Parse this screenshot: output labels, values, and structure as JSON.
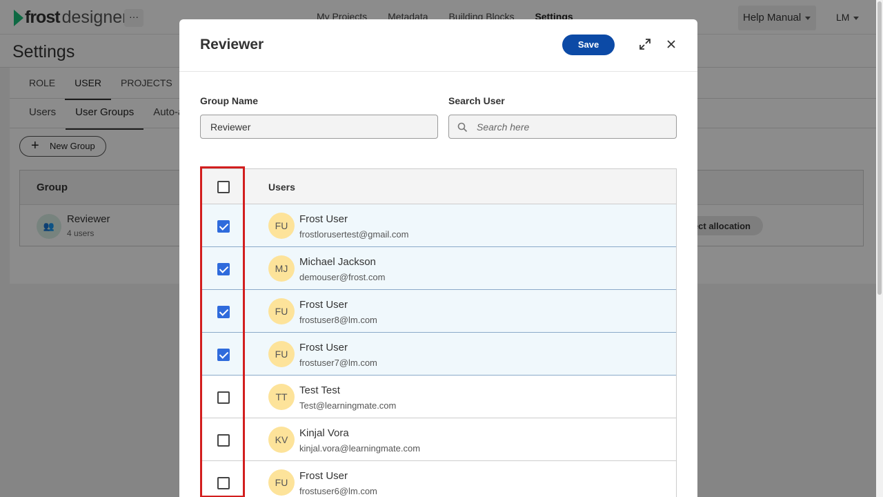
{
  "app": {
    "logo_bold": "frost",
    "logo_light": "designer",
    "more_label": "···",
    "nav": [
      "My Projects",
      "Metadata",
      "Building Blocks",
      "Settings"
    ],
    "help_label": "Help Manual",
    "user_initials": "LM"
  },
  "settings": {
    "title": "Settings",
    "tabs": [
      "ROLE",
      "USER",
      "PROJECTS"
    ],
    "subtabs": [
      "Users",
      "User Groups",
      "Auto-as"
    ],
    "new_group_label": "New Group",
    "group_header": "Group",
    "group_name": "Reviewer",
    "group_count": "4 users",
    "allocation_label": "ect allocation"
  },
  "modal": {
    "title": "Reviewer",
    "save_label": "Save",
    "group_name_label": "Group Name",
    "group_name_value": "Reviewer",
    "search_label": "Search User",
    "search_placeholder": "Search here",
    "users_header": "Users",
    "users": [
      {
        "initials": "FU",
        "name": "Frost User",
        "email": "frostlorusertest@gmail.com",
        "checked": true
      },
      {
        "initials": "MJ",
        "name": "Michael Jackson",
        "email": "demouser@frost.com",
        "checked": true
      },
      {
        "initials": "FU",
        "name": "Frost User",
        "email": "frostuser8@lm.com",
        "checked": true
      },
      {
        "initials": "FU",
        "name": "Frost User",
        "email": "frostuser7@lm.com",
        "checked": true
      },
      {
        "initials": "TT",
        "name": "Test Test",
        "email": "Test@learningmate.com",
        "checked": false
      },
      {
        "initials": "KV",
        "name": "Kinjal Vora",
        "email": "kinjal.vora@learningmate.com",
        "checked": false
      },
      {
        "initials": "FU",
        "name": "Frost User",
        "email": "frostuser6@lm.com",
        "checked": false
      }
    ]
  },
  "colors": {
    "primary": "#0c4aa6",
    "checkbox_checked": "#2f6bdc",
    "avatar": "#fde39a",
    "highlight": "#d21e1e",
    "brand_green": "#1bbf7a"
  }
}
